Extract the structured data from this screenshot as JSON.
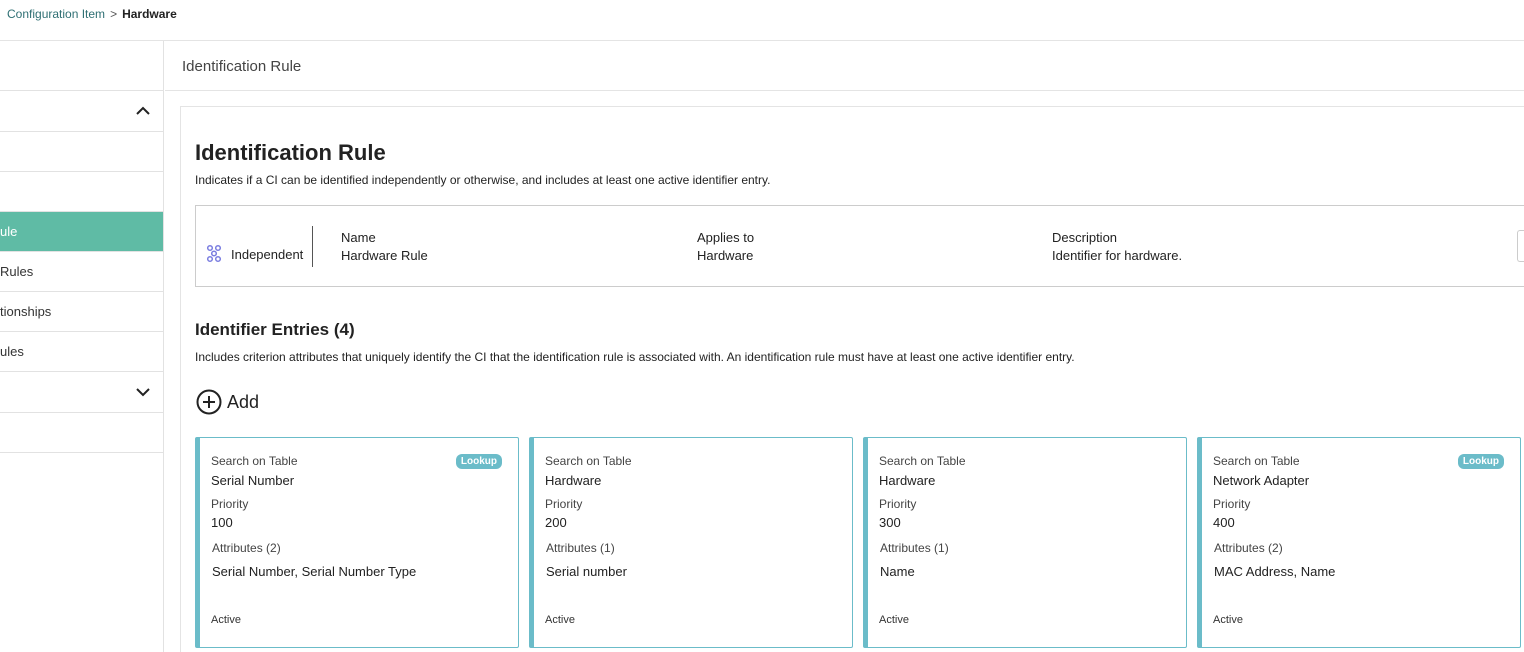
{
  "breadcrumb": {
    "parent": "Configuration Item",
    "separator": ">",
    "current": "Hardware"
  },
  "sidebar": {
    "items": [
      {
        "label": ""
      },
      {
        "label": ""
      },
      {
        "label": "ule"
      },
      {
        "label": "Rules"
      },
      {
        "label": "tionships"
      },
      {
        "label": "ules"
      },
      {
        "label": ""
      }
    ]
  },
  "section_header": "Identification Rule",
  "page": {
    "title": "Identification Rule",
    "subtitle": "Indicates if a CI can be identified independently or otherwise, and includes at least one active identifier entry."
  },
  "rule": {
    "type": "Independent",
    "name_label": "Name",
    "name_value": "Hardware Rule",
    "applies_label": "Applies to",
    "applies_value": "Hardware",
    "desc_label": "Description",
    "desc_value": "Identifier for hardware."
  },
  "entries": {
    "title": "Identifier Entries (4)",
    "subtitle": "Includes criterion attributes that uniquely identify the CI that the identification rule is associated with. An identification rule must have at least one active identifier entry.",
    "add_label": "Add",
    "cards": [
      {
        "table_label": "Search on Table",
        "table": "Serial Number",
        "priority_label": "Priority",
        "priority": "100",
        "attr_label": "Attributes (2)",
        "attrs": "Serial Number, Serial Number Type",
        "status": "Active",
        "badge": "Lookup"
      },
      {
        "table_label": "Search on Table",
        "table": "Hardware",
        "priority_label": "Priority",
        "priority": "200",
        "attr_label": "Attributes (1)",
        "attrs": "Serial number",
        "status": "Active",
        "badge": ""
      },
      {
        "table_label": "Search on Table",
        "table": "Hardware",
        "priority_label": "Priority",
        "priority": "300",
        "attr_label": "Attributes (1)",
        "attrs": "Name",
        "status": "Active",
        "badge": ""
      },
      {
        "table_label": "Search on Table",
        "table": "Network Adapter",
        "priority_label": "Priority",
        "priority": "400",
        "attr_label": "Attributes (2)",
        "attrs": "MAC Address, Name",
        "status": "Active",
        "badge": "Lookup"
      }
    ]
  },
  "colors": {
    "accent": "#5fbba5",
    "card_border": "#6bbcc9",
    "breadcrumb_link": "#2e6f73"
  }
}
